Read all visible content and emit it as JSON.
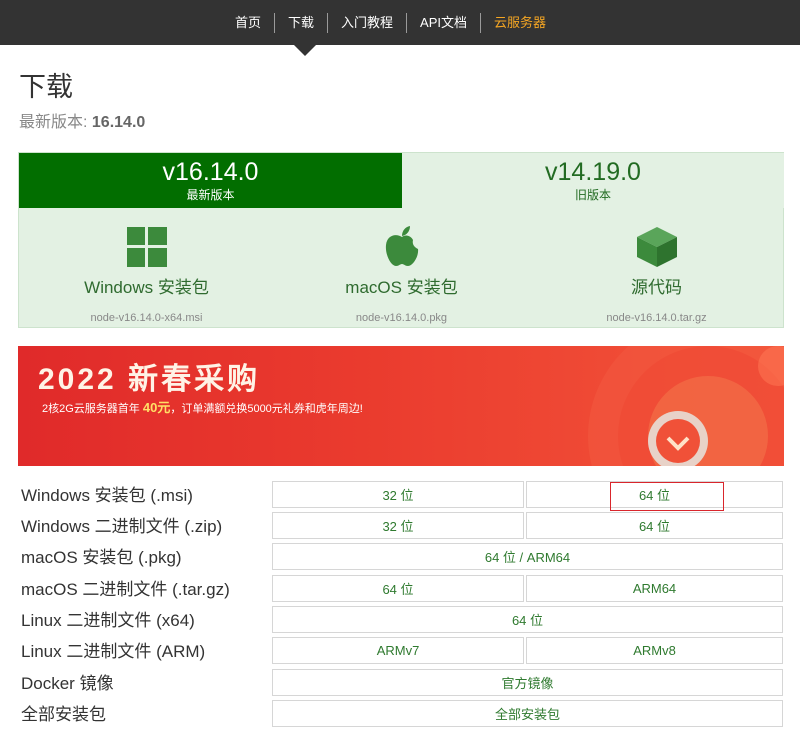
{
  "nav": {
    "items": [
      {
        "label": "首页"
      },
      {
        "label": "下载"
      },
      {
        "label": "入门教程"
      },
      {
        "label": "API文档"
      },
      {
        "label": "云服务器"
      }
    ]
  },
  "page": {
    "title": "下载",
    "latest_prefix": "最新版本: ",
    "latest_version": "16.14.0"
  },
  "versions": {
    "current": {
      "version": "v16.14.0",
      "label": "最新版本"
    },
    "old": {
      "version": "v14.19.0",
      "label": "旧版本"
    }
  },
  "downloads": [
    {
      "name": "Windows 安装包",
      "file": "node-v16.14.0-x64.msi",
      "icon": "windows-icon"
    },
    {
      "name": "macOS 安装包",
      "file": "node-v16.14.0.pkg",
      "icon": "apple-icon"
    },
    {
      "name": "源代码",
      "file": "node-v16.14.0.tar.gz",
      "icon": "source-box-icon"
    }
  ],
  "banner": {
    "title": "2022 新春采购",
    "sub_before": "2核2G云服务器首年 ",
    "sub_highlight": "40元",
    "sub_after": "，订单满额兑换5000元礼券和虎年周边!"
  },
  "table": {
    "rows": [
      {
        "label": "Windows 安装包 (.msi)",
        "cells": [
          "32 位",
          "64 位"
        ]
      },
      {
        "label": "Windows 二进制文件 (.zip)",
        "cells": [
          "32 位",
          "64 位"
        ]
      },
      {
        "label": "macOS 安装包 (.pkg)",
        "cells": [
          "64 位 / ARM64"
        ]
      },
      {
        "label": "macOS 二进制文件 (.tar.gz)",
        "cells": [
          "64 位",
          "ARM64"
        ]
      },
      {
        "label": "Linux 二进制文件 (x64)",
        "cells": [
          "64 位"
        ]
      },
      {
        "label": "Linux 二进制文件 (ARM)",
        "cells": [
          "ARMv7",
          "ARMv8"
        ]
      },
      {
        "label": "Docker 镜像",
        "cells": [
          "官方镜像"
        ]
      },
      {
        "label": "全部安装包",
        "cells": [
          "全部安装包"
        ]
      }
    ]
  },
  "colors": {
    "nav_bg": "#333333",
    "nav_accent": "#f5a623",
    "brand_green": "#026e00",
    "panel_bg": "#e3f1e3",
    "highlight_red": "#d9262c"
  }
}
